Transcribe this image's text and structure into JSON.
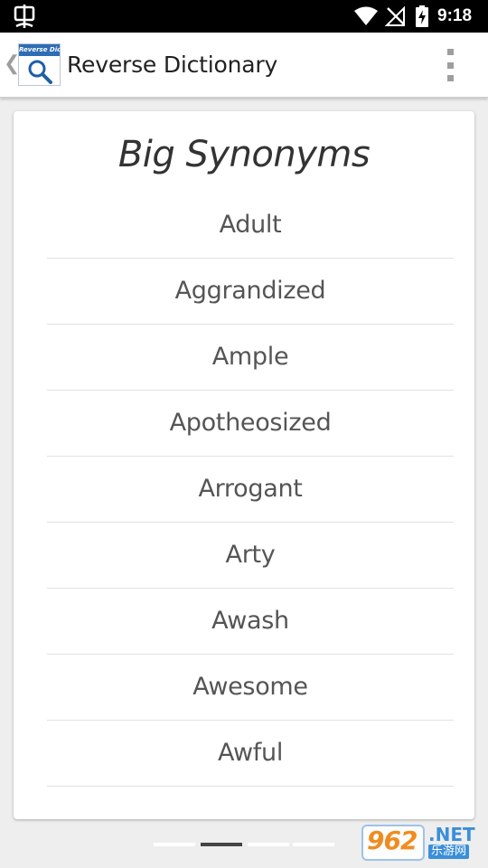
{
  "status_bar": {
    "time": "9:18",
    "icons": [
      "notification-icon",
      "wifi-icon",
      "no-signal-icon",
      "battery-charging-icon"
    ]
  },
  "app_bar": {
    "logo_text": "Reverse Dict.",
    "title": "Reverse Dictionary",
    "icons": [
      "back-chevron-icon",
      "app-logo-icon",
      "overflow-menu-icon"
    ]
  },
  "card": {
    "title": "Big Synonyms",
    "words": [
      "Adult",
      "Aggrandized",
      "Ample",
      "Apotheosized",
      "Arrogant",
      "Arty",
      "Awash",
      "Awesome",
      "Awful"
    ]
  },
  "pager": {
    "pages": 4,
    "active_index": 1
  },
  "watermark": {
    "number": "962",
    "suffix": ".NET",
    "sub": "乐游网"
  },
  "colors": {
    "status_bar": "#000000",
    "app_bar": "#ffffff",
    "background": "#eeeeee",
    "logo_banner": "#2e6db5",
    "watermark_orange": "#f08c1f",
    "watermark_blue": "#3b8fd9"
  }
}
